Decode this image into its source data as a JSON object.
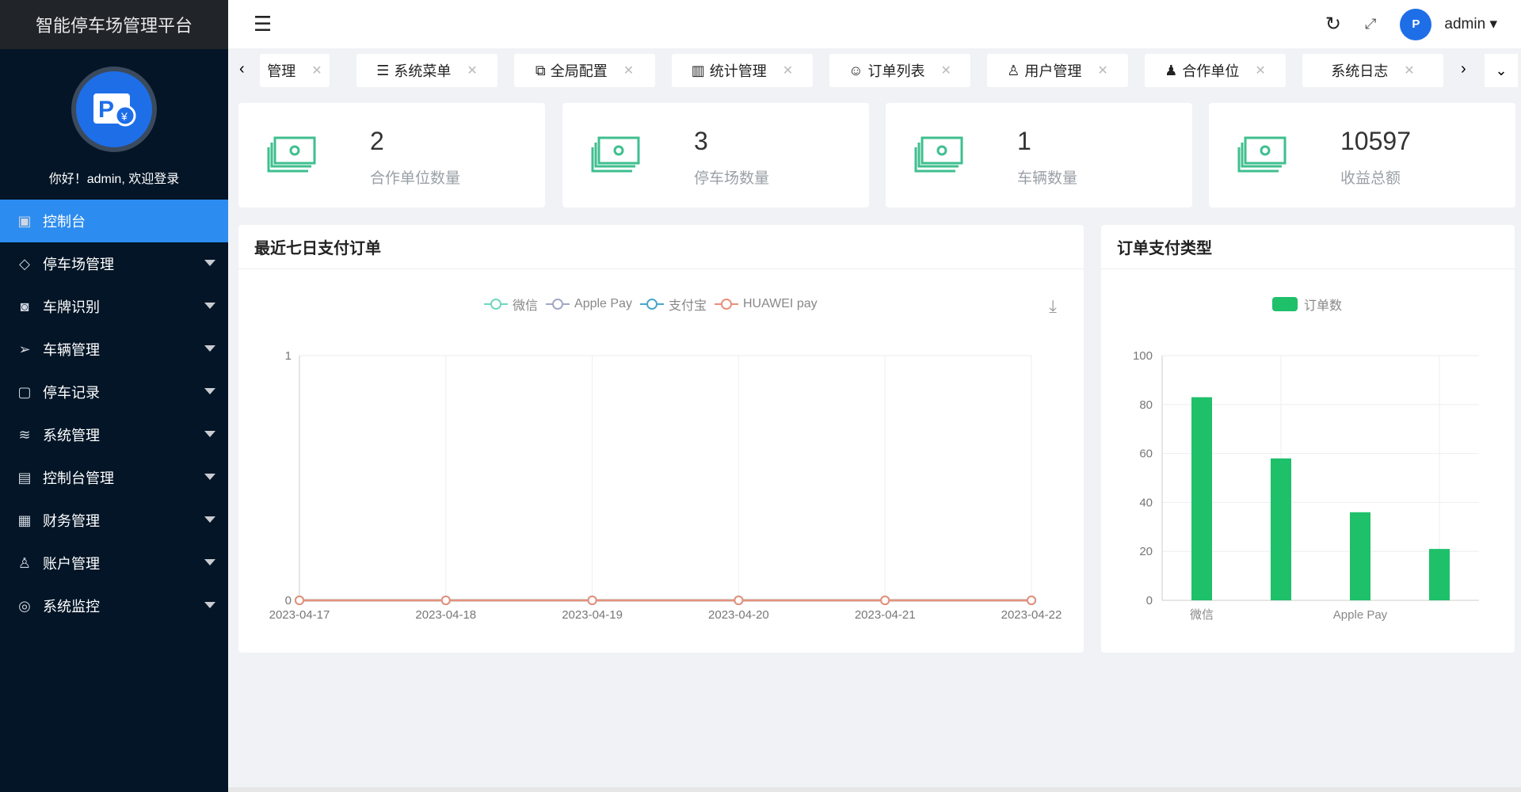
{
  "app": {
    "title": "智能停车场管理平台",
    "welcome": "你好！admin, 欢迎登录"
  },
  "sidebar": {
    "items": [
      {
        "label": "控制台",
        "icon": "dashboard-icon",
        "active": true
      },
      {
        "label": "停车场管理",
        "icon": "diamond-icon"
      },
      {
        "label": "车牌识别",
        "icon": "camera-icon"
      },
      {
        "label": "车辆管理",
        "icon": "send-icon"
      },
      {
        "label": "停车记录",
        "icon": "note-icon"
      },
      {
        "label": "系统管理",
        "icon": "layers-icon"
      },
      {
        "label": "控制台管理",
        "icon": "clipboard-icon"
      },
      {
        "label": "财务管理",
        "icon": "apps-icon"
      },
      {
        "label": "账户管理",
        "icon": "user-icon"
      },
      {
        "label": "系统监控",
        "icon": "camera-outline-icon"
      }
    ]
  },
  "header": {
    "user": "admin"
  },
  "tabs": [
    {
      "label": "管理"
    },
    {
      "label": "系统菜单"
    },
    {
      "label": "全局配置"
    },
    {
      "label": "统计管理"
    },
    {
      "label": "订单列表"
    },
    {
      "label": "用户管理"
    },
    {
      "label": "合作单位"
    },
    {
      "label": "系统日志"
    }
  ],
  "stats": [
    {
      "value": "2",
      "label": "合作单位数量"
    },
    {
      "value": "3",
      "label": "停车场数量"
    },
    {
      "value": "1",
      "label": "车辆数量"
    },
    {
      "value": "10597",
      "label": "收益总额"
    }
  ],
  "colors": {
    "accent": "#2d8cf0",
    "bar": "#1ec06a",
    "stat_icon": "#3fbf8f"
  },
  "chart_data": [
    {
      "type": "line",
      "title": "最近七日支付订单",
      "x": [
        "2023-04-17",
        "2023-04-18",
        "2023-04-19",
        "2023-04-20",
        "2023-04-21",
        "2023-04-22"
      ],
      "series": [
        {
          "name": "微信",
          "values": [
            0,
            0,
            0,
            0,
            0,
            0
          ],
          "color": "#6fd6c0"
        },
        {
          "name": "Apple Pay",
          "values": [
            0,
            0,
            0,
            0,
            0,
            0
          ],
          "color": "#a3a6c4"
        },
        {
          "name": "支付宝",
          "values": [
            0,
            0,
            0,
            0,
            0,
            0
          ],
          "color": "#4aa6c9"
        },
        {
          "name": "HUAWEI pay",
          "values": [
            0,
            0,
            0,
            0,
            0,
            0
          ],
          "color": "#e8907a"
        }
      ],
      "ylim": [
        0,
        1
      ],
      "yticks": [
        "0",
        "1"
      ],
      "legend": "top-center",
      "grid": true
    },
    {
      "type": "bar",
      "title": "订单支付类型",
      "categories": [
        "微信",
        "",
        "Apple Pay",
        ""
      ],
      "series": [
        {
          "name": "订单数",
          "values": [
            83,
            58,
            36,
            21
          ]
        }
      ],
      "ylim": [
        0,
        100
      ],
      "yticks": [
        "0",
        "20",
        "40",
        "60",
        "80",
        "100"
      ],
      "legend": "top-center",
      "grid": true
    }
  ]
}
